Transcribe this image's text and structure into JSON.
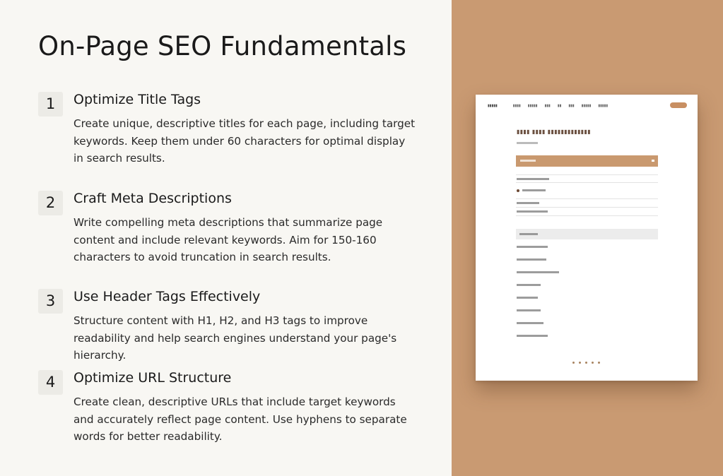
{
  "page": {
    "title": "On-Page SEO Fundamentals"
  },
  "items": [
    {
      "number": "1",
      "title": "Optimize Title Tags",
      "body": "Create unique, descriptive titles for each page, including target keywords. Keep them under 60 characters for optimal display in search results."
    },
    {
      "number": "2",
      "title": "Craft Meta Descriptions",
      "body": "Write compelling meta descriptions that summarize page content and include relevant keywords. Aim for 150-160 characters to avoid truncation in search results."
    },
    {
      "number": "3",
      "title": "Use Header Tags Effectively",
      "body": "Structure content with H1, H2, and H3 tags to improve readability and help search engines understand your page's hierarchy."
    },
    {
      "number": "4",
      "title": "Optimize URL Structure",
      "body": "Create clean, descriptive URLs that include target keywords and accurately reflect page content. Use hyphens to separate words for better readability."
    }
  ],
  "colors": {
    "background_left": "#f8f7f3",
    "background_right": "#c99a72",
    "number_badge": "#ecebe6",
    "mock_accent": "#c9996f"
  }
}
